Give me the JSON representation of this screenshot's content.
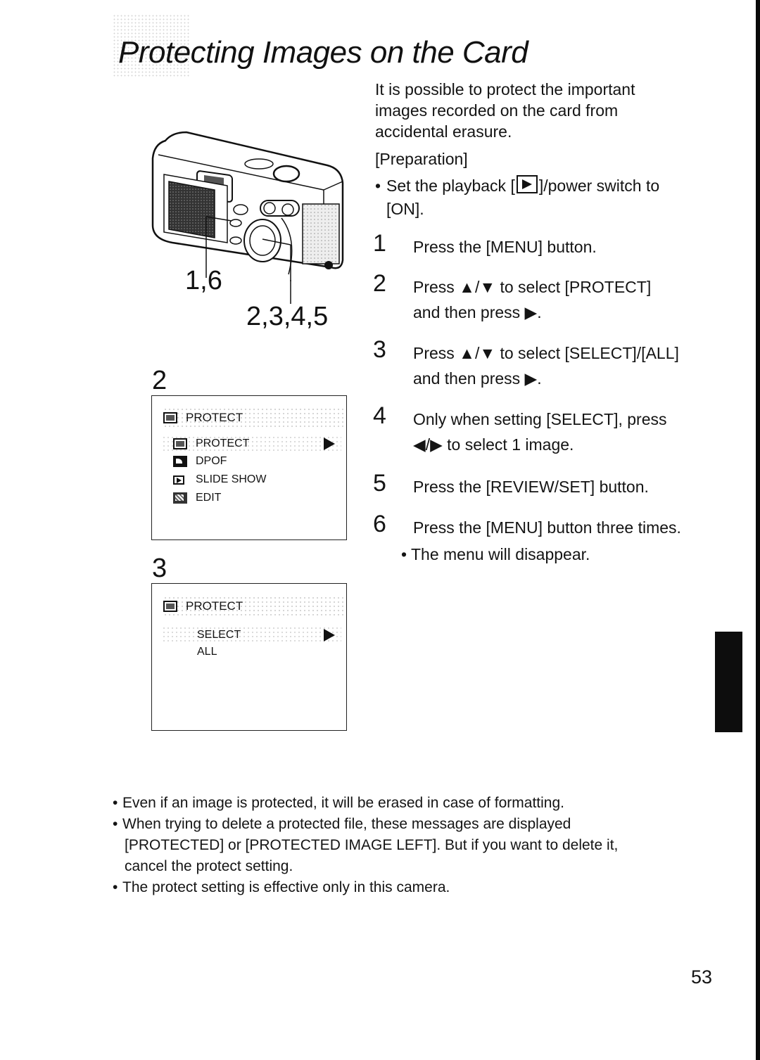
{
  "page": {
    "title": "Protecting Images on the Card",
    "page_number": "53",
    "colors": {
      "ink": "#141414",
      "paper": "#ffffff",
      "tab": "#0d0d0d"
    }
  },
  "intro": {
    "text": "It is possible to protect the important images recorded on the card from accidental erasure."
  },
  "preparation": {
    "label": "[Preparation]",
    "bullet_pre": "Set the playback [",
    "icon": "playback-icon",
    "bullet_post": "]/power switch to",
    "bullet_cont": "[ON]."
  },
  "steps": [
    {
      "num": "1",
      "text": "Press the [MENU] button."
    },
    {
      "num": "2",
      "text": "Press ▲/▼ to select [PROTECT] and then press ▶."
    },
    {
      "num": "3",
      "text": "Press ▲/▼ to select [SELECT]/[ALL] and then press ▶."
    },
    {
      "num": "4",
      "text": "Only when setting [SELECT], press ◀/▶ to select 1 image."
    },
    {
      "num": "5",
      "text": "Press the [REVIEW/SET] button."
    },
    {
      "num": "6",
      "text": "Press the [MENU] button three times."
    }
  ],
  "step6_sub": "The menu will disappear.",
  "figure": {
    "callout_a": "1,6",
    "callout_b": "2,3,4,5"
  },
  "screen2": {
    "label": "2",
    "header": "PROTECT",
    "items": [
      {
        "icon": "protect-key-icon",
        "label": "PROTECT",
        "selected": true
      },
      {
        "icon": "dpof-icon",
        "label": "DPOF",
        "selected": false
      },
      {
        "icon": "slide-show-icon",
        "label": "SLIDE SHOW",
        "selected": false
      },
      {
        "icon": "edit-icon",
        "label": "EDIT",
        "selected": false
      }
    ]
  },
  "screen3": {
    "label": "3",
    "header": "PROTECT",
    "items": [
      {
        "label": "SELECT",
        "selected": true
      },
      {
        "label": "ALL",
        "selected": false
      }
    ]
  },
  "notes": [
    "Even if an image is protected, it will be erased in case of formatting.",
    "When trying to delete a protected file, these messages are displayed",
    "[PROTECTED] or [PROTECTED IMAGE LEFT]. But if you want to delete it,",
    "cancel the protect setting.",
    "The protect setting is effective only in this camera."
  ]
}
